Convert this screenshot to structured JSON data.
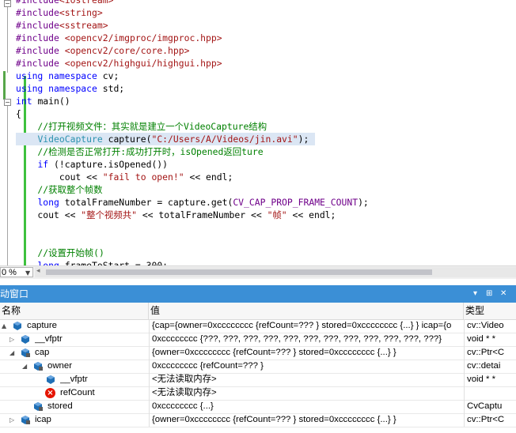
{
  "editor": {
    "lines": [
      {
        "tokens": [
          {
            "t": "#include",
            "c": "mac"
          },
          {
            "t": "<iostream>",
            "c": "str"
          }
        ]
      },
      {
        "tokens": [
          {
            "t": "#include",
            "c": "mac"
          },
          {
            "t": "<string>",
            "c": "str"
          }
        ]
      },
      {
        "tokens": [
          {
            "t": "#include",
            "c": "mac"
          },
          {
            "t": "<sstream>",
            "c": "str"
          }
        ]
      },
      {
        "tokens": [
          {
            "t": "#include ",
            "c": "mac"
          },
          {
            "t": "<opencv2/imgproc/imgproc.hpp>",
            "c": "str"
          }
        ]
      },
      {
        "tokens": [
          {
            "t": "#include ",
            "c": "mac"
          },
          {
            "t": "<opencv2/core/core.hpp>",
            "c": "str"
          }
        ]
      },
      {
        "tokens": [
          {
            "t": "#include ",
            "c": "mac"
          },
          {
            "t": "<opencv2/highgui/highgui.hpp>",
            "c": "str"
          }
        ]
      },
      {
        "tokens": [
          {
            "t": "using ",
            "c": "kw"
          },
          {
            "t": "namespace ",
            "c": "kw"
          },
          {
            "t": "cv;",
            "c": ""
          }
        ]
      },
      {
        "tokens": [
          {
            "t": "using ",
            "c": "kw"
          },
          {
            "t": "namespace ",
            "c": "kw"
          },
          {
            "t": "std;",
            "c": ""
          }
        ]
      },
      {
        "tokens": [
          {
            "t": "int ",
            "c": "kw"
          },
          {
            "t": "main()",
            "c": ""
          }
        ]
      },
      {
        "tokens": [
          {
            "t": "{",
            "c": ""
          }
        ]
      },
      {
        "tokens": [
          {
            "t": "    //打开视频文件：其实就是建立一个VideoCapture结构",
            "c": "cm"
          }
        ]
      },
      {
        "hl": true,
        "tokens": [
          {
            "t": "    ",
            "c": ""
          },
          {
            "t": "VideoCapture",
            "c": "type"
          },
          {
            "t": " capture(",
            "c": ""
          },
          {
            "t": "\"C:/Users/A/Videos/jin.avi\"",
            "c": "str"
          },
          {
            "t": ");",
            "c": ""
          }
        ]
      },
      {
        "tokens": [
          {
            "t": "    //检测是否正常打开:成功打开时，isOpened返回ture",
            "c": "cm"
          }
        ]
      },
      {
        "tokens": [
          {
            "t": "    ",
            "c": ""
          },
          {
            "t": "if",
            "c": "kw"
          },
          {
            "t": " (!capture.isOpened())",
            "c": ""
          }
        ]
      },
      {
        "tokens": [
          {
            "t": "        cout << ",
            "c": ""
          },
          {
            "t": "\"fail to open!\"",
            "c": "str"
          },
          {
            "t": " << endl;",
            "c": ""
          }
        ]
      },
      {
        "tokens": [
          {
            "t": "    //获取整个帧数",
            "c": "cm"
          }
        ]
      },
      {
        "tokens": [
          {
            "t": "    ",
            "c": ""
          },
          {
            "t": "long",
            "c": "kw"
          },
          {
            "t": " totalFrameNumber = capture.get(",
            "c": ""
          },
          {
            "t": "CV_CAP_PROP_FRAME_COUNT",
            "c": "mac"
          },
          {
            "t": ");",
            "c": ""
          }
        ]
      },
      {
        "tokens": [
          {
            "t": "    cout << ",
            "c": ""
          },
          {
            "t": "\"整个视频共\"",
            "c": "str"
          },
          {
            "t": " << totalFrameNumber << ",
            "c": ""
          },
          {
            "t": "\"帧\"",
            "c": "str"
          },
          {
            "t": " << endl;",
            "c": ""
          }
        ]
      },
      {
        "tokens": [
          {
            "t": "",
            "c": ""
          }
        ]
      },
      {
        "tokens": [
          {
            "t": "",
            "c": ""
          }
        ]
      },
      {
        "tokens": [
          {
            "t": "    //设置开始帧()",
            "c": "cm"
          }
        ]
      },
      {
        "tokens": [
          {
            "t": "    ",
            "c": ""
          },
          {
            "t": "long",
            "c": "kw"
          },
          {
            "t": " frameToStart = 300;",
            "c": ""
          }
        ]
      }
    ],
    "zoom": "0 %",
    "zoom_arrow": "▼"
  },
  "auto_window": {
    "title": "动窗口",
    "pin_icon": "▾",
    "dock_icon": "⊞",
    "close_icon": "✕",
    "columns": {
      "name": "名称",
      "value": "值",
      "type": "类型"
    },
    "rows": [
      {
        "level": 0,
        "expand": "▲",
        "icon": "struct",
        "name": "capture",
        "value": "{cap={owner=0xcccccccc {refCount=??? } stored=0xcccccccc {...} } icap={o",
        "type": "cv::Video"
      },
      {
        "level": 1,
        "expand": "▷",
        "icon": "struct",
        "name": "__vfptr",
        "value": "0xcccccccc {???, ???, ???, ???, ???, ???, ???, ???, ???, ???, ???, ???}",
        "type": "void * *"
      },
      {
        "level": 1,
        "expand": "◢",
        "icon": "field",
        "name": "cap",
        "value": "{owner=0xcccccccc {refCount=??? } stored=0xcccccccc {...} }",
        "type": "cv::Ptr<C"
      },
      {
        "level": 2,
        "expand": "◢",
        "icon": "field",
        "name": "owner",
        "value": "0xcccccccc {refCount=??? }",
        "type": "cv::detai"
      },
      {
        "level": 3,
        "expand": "",
        "icon": "struct",
        "name": "__vfptr",
        "value": "<无法读取内存>",
        "type": "void * *"
      },
      {
        "level": 3,
        "expand": "",
        "icon": "error",
        "name": "refCount",
        "value": "<无法读取内存>",
        "type": ""
      },
      {
        "level": 2,
        "expand": "",
        "icon": "field",
        "name": "stored",
        "value": "0xcccccccc {...}",
        "type": "CvCaptu"
      },
      {
        "level": 1,
        "expand": "▷",
        "icon": "field",
        "name": "icap",
        "value": "{owner=0xcccccccc {refCount=??? } stored=0xcccccccc {...} }",
        "type": "cv::Ptr<C"
      }
    ]
  },
  "colors": {
    "accent": "#3b8fd6",
    "error": "#e51400",
    "icon_blue": "#1f6fb5"
  }
}
